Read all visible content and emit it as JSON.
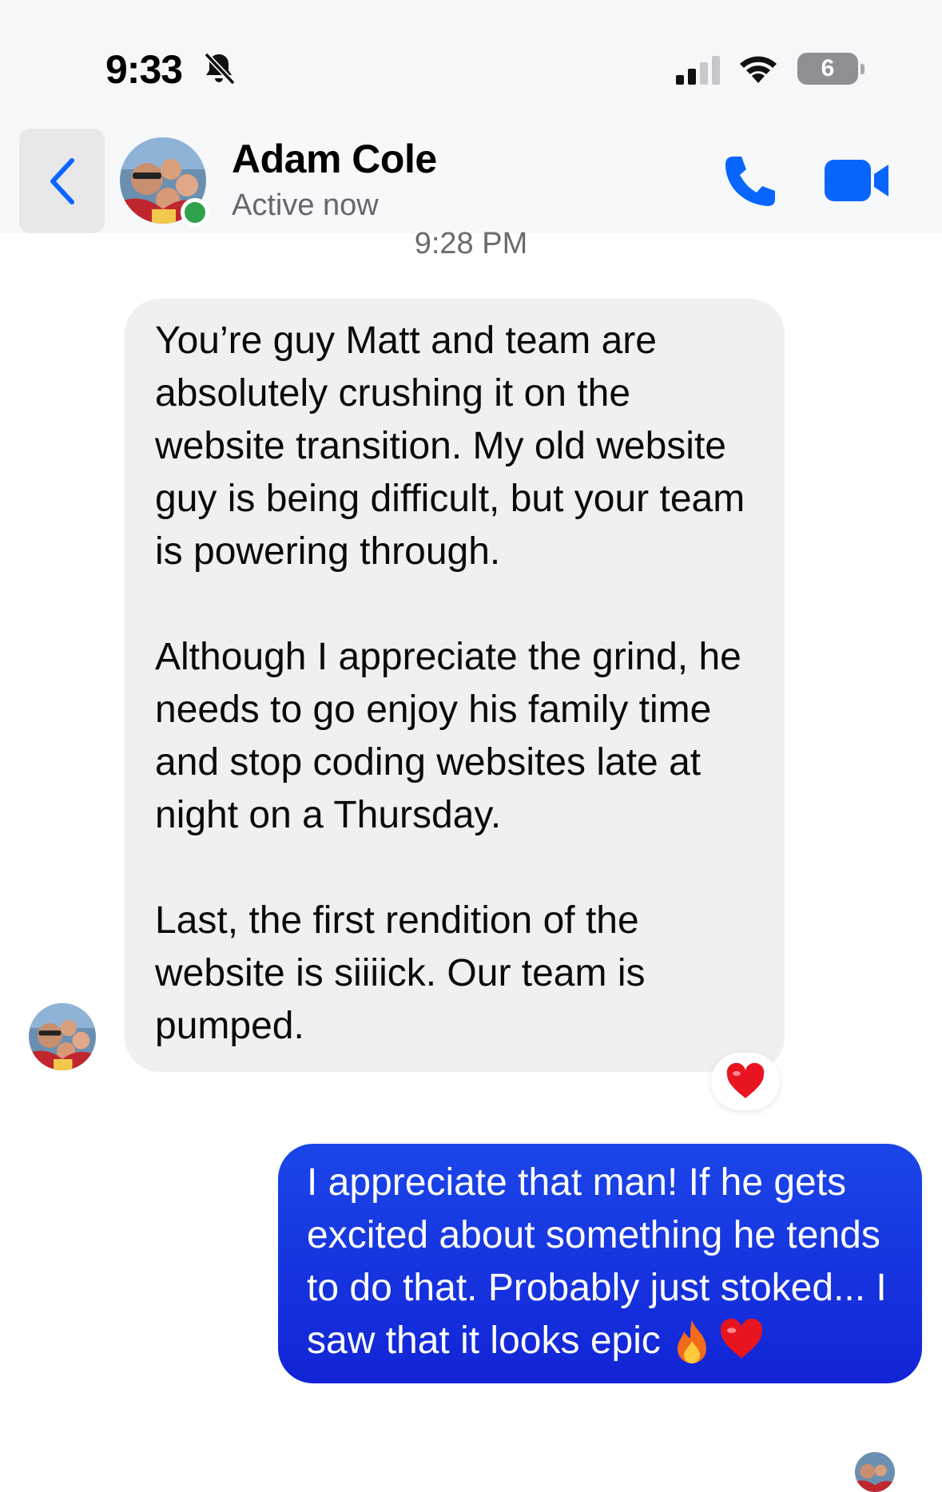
{
  "status_bar": {
    "time": "9:33",
    "battery_level": "6"
  },
  "header": {
    "contact_name": "Adam Cole",
    "contact_status": "Active now"
  },
  "conversation": {
    "timestamp": "9:28 PM",
    "incoming_message": {
      "paragraphs": [
        "You’re guy Matt and team are absolutely crushing it on the website transition. My old website guy is being difficult, but your team is powering through.",
        "Although I appreciate the grind, he needs to go enjoy his family time and stop coding websites late at night on a Thursday.",
        "Last, the first rendition of the website is siiiick. Our team is pumped."
      ],
      "reaction_icon": "heart-icon"
    },
    "outgoing_message": {
      "text": "I appreciate that man! If he gets excited about something he tends to do that. Probably just stoked... I saw that it looks epic",
      "emojis": [
        "fire-icon",
        "heart-icon"
      ]
    }
  },
  "colors": {
    "accent": "#0866ff",
    "outgoing_bubble": "#1434e0",
    "incoming_bubble": "#f0f0f3",
    "online": "#31a24c"
  }
}
